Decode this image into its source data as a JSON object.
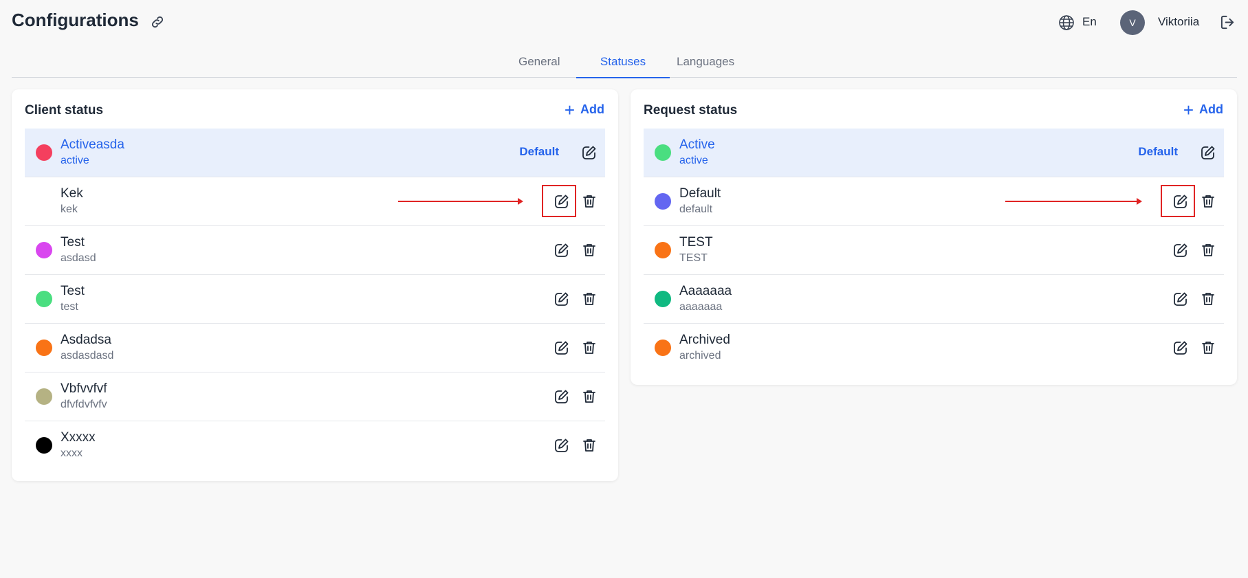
{
  "header": {
    "title": "Configurations",
    "language": "En",
    "avatar_initial": "V",
    "username": "Viktoriia"
  },
  "tabs": [
    {
      "label": "General",
      "active": false
    },
    {
      "label": "Statuses",
      "active": true
    },
    {
      "label": "Languages",
      "active": false
    }
  ],
  "client_status": {
    "title": "Client status",
    "add_label": "Add",
    "rows": [
      {
        "name": "Activeasda",
        "code": "active",
        "color": "#f43f5e",
        "default": true,
        "default_label": "Default"
      },
      {
        "name": "Kek",
        "code": "kek",
        "color": "transparent",
        "default": false
      },
      {
        "name": "Test",
        "code": "asdasd",
        "color": "#d946ef",
        "default": false
      },
      {
        "name": "Test",
        "code": "test",
        "color": "#4ade80",
        "default": false
      },
      {
        "name": "Asdadsa",
        "code": "asdasdasd",
        "color": "#f97316",
        "default": false
      },
      {
        "name": "Vbfvvfvf",
        "code": "dfvfdvfvfv",
        "color": "#b5b283",
        "default": false
      },
      {
        "name": "Xxxxx",
        "code": "xxxx",
        "color": "#000000",
        "default": false
      }
    ]
  },
  "request_status": {
    "title": "Request status",
    "add_label": "Add",
    "rows": [
      {
        "name": "Active",
        "code": "active",
        "color": "#4ade80",
        "default": true,
        "default_label": "Default"
      },
      {
        "name": "Default",
        "code": "default",
        "color": "#6366f1",
        "default": false
      },
      {
        "name": "TEST",
        "code": "TEST",
        "color": "#f97316",
        "default": false
      },
      {
        "name": "Aaaaaaa",
        "code": "aaaaaaa",
        "color": "#10b981",
        "default": false
      },
      {
        "name": "Archived",
        "code": "archived",
        "color": "#f97316",
        "default": false
      }
    ]
  },
  "icons": {
    "link": "link-icon",
    "globe": "globe-icon",
    "logout": "logout-icon",
    "edit": "edit-icon",
    "delete": "trash-icon",
    "add": "plus-icon"
  }
}
